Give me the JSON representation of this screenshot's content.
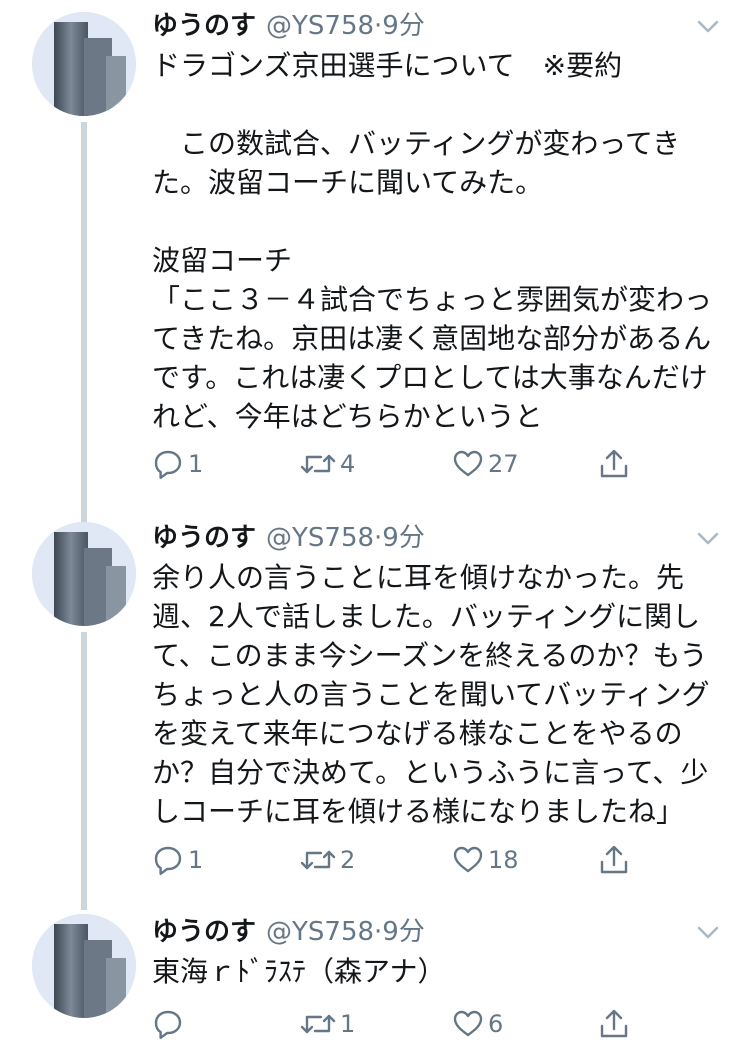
{
  "colors": {
    "text": "#14171a",
    "secondary": "#657786",
    "thread_line": "#cdd6dd"
  },
  "tweets": [
    {
      "name": "ゆうのす",
      "handle": "@YS758",
      "separator": "·",
      "time": "9分",
      "text": "ドラゴンズ京田選手について　※要約\n\n　この数試合、バッティングが変わってきた。波留コーチに聞いてみた。\n\n波留コーチ\n「ここ３－４試合でちょっと雰囲気が変わってきたね。京田は凄く意固地な部分があるんです。これは凄くプロとしては大事なんだけれど、今年はどちらかというと",
      "replies": "1",
      "retweets": "4",
      "likes": "27"
    },
    {
      "name": "ゆうのす",
      "handle": "@YS758",
      "separator": "·",
      "time": "9分",
      "text": "余り人の言うことに耳を傾けなかった。先週、2人で話しました。バッティングに関して、このまま今シーズンを終えるのか？もうちょっと人の言うことを聞いてバッティングを変えて来年につなげる様なことをやるのか？自分で決めて。というふうに言って、少しコーチに耳を傾ける様になりましたね」",
      "replies": "1",
      "retweets": "2",
      "likes": "18"
    },
    {
      "name": "ゆうのす",
      "handle": "@YS758",
      "separator": "·",
      "time": "9分",
      "text": "東海ｒﾄﾞﾗｽﾃ（森アナ）",
      "replies": "",
      "retweets": "1",
      "likes": "6"
    }
  ],
  "icons": {
    "reply": "reply-icon",
    "retweet": "retweet-icon",
    "like": "heart-icon",
    "share": "share-icon",
    "menu": "chevron-down-icon"
  }
}
